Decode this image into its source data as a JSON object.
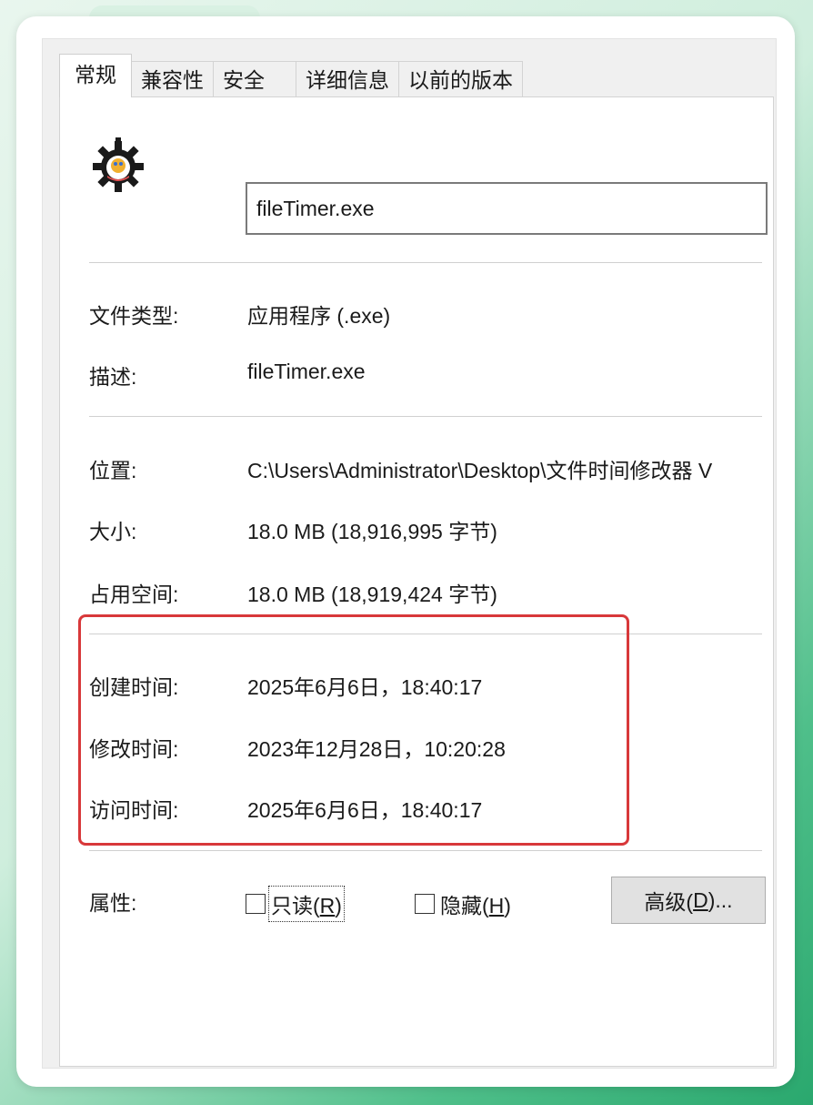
{
  "tabs": [
    "常规",
    "兼容性",
    "安全",
    "详细信息",
    "以前的版本"
  ],
  "file_name": "fileTimer.exe",
  "file_type": {
    "label": "文件类型:",
    "value": "应用程序 (.exe)"
  },
  "description": {
    "label": "描述:",
    "value": "fileTimer.exe"
  },
  "location": {
    "label": "位置:",
    "value": "C:\\Users\\Administrator\\Desktop\\文件时间修改器 V"
  },
  "size": {
    "label": "大小:",
    "value": "18.0 MB (18,916,995 字节)"
  },
  "size_on_disk": {
    "label": "占用空间:",
    "value": "18.0 MB (18,919,424 字节)"
  },
  "created": {
    "label": "创建时间:",
    "value": "2025年6月6日，18:40:17"
  },
  "modified": {
    "label": "修改时间:",
    "value": "2023年12月28日，10:20:28"
  },
  "accessed": {
    "label": "访问时间:",
    "value": "2025年6月6日，18:40:17"
  },
  "attributes": {
    "label": "属性:",
    "readonly": {
      "text": "只读(",
      "key": "R",
      "tail": ")"
    },
    "hidden": {
      "text": "隐藏(",
      "key": "H",
      "tail": ")"
    },
    "advanced": {
      "text": "高级(",
      "key": "D",
      "tail": ")..."
    }
  },
  "colors": {
    "highlight": "#d8383a",
    "panel": "#ffffff",
    "dialog": "#f0f0f0"
  },
  "icons": {
    "app": "gear-icon"
  }
}
